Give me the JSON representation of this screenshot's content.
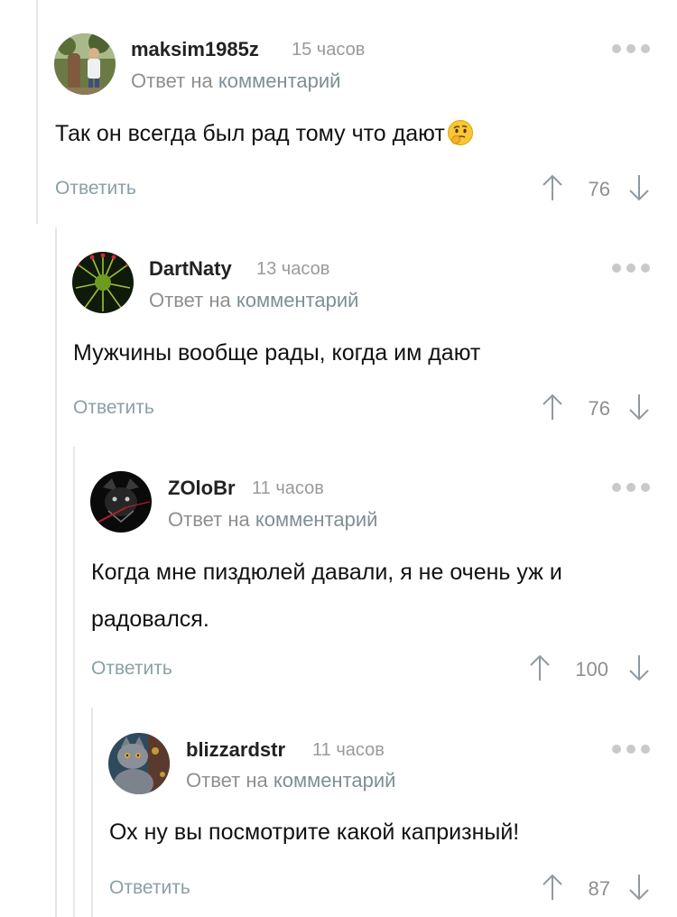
{
  "comments": [
    {
      "username": "maksim1985z",
      "time": "15 часов",
      "reply_prefix": "Ответ на",
      "reply_link": "комментарий",
      "text": "Так он всегда был рад тому что дают",
      "emoji": "thinking-face-icon",
      "reply_label": "Ответить",
      "score": "76"
    },
    {
      "username": "DartNaty",
      "time": "13 часов",
      "reply_prefix": "Ответ на",
      "reply_link": "комментарий",
      "text": "Мужчины вообще рады, когда им дают",
      "reply_label": "Ответить",
      "score": "76"
    },
    {
      "username": "ZOloBr",
      "time": "11 часов",
      "reply_prefix": "Ответ на",
      "reply_link": "комментарий",
      "text": "Когда мне пиздюлей давали, я не очень уж и радовался.",
      "reply_label": "Ответить",
      "score": "100"
    },
    {
      "username": "blizzardstr",
      "time": "11 часов",
      "reply_prefix": "Ответ на",
      "reply_link": "комментарий",
      "text": "Ох ну вы посмотрите какой капризный!",
      "reply_label": "Ответить",
      "score": "87"
    }
  ],
  "colors": {
    "meta_gray": "#9a9a9a",
    "link_gray_blue": "#7e8f95",
    "thread_line": "#e8e8e8"
  }
}
